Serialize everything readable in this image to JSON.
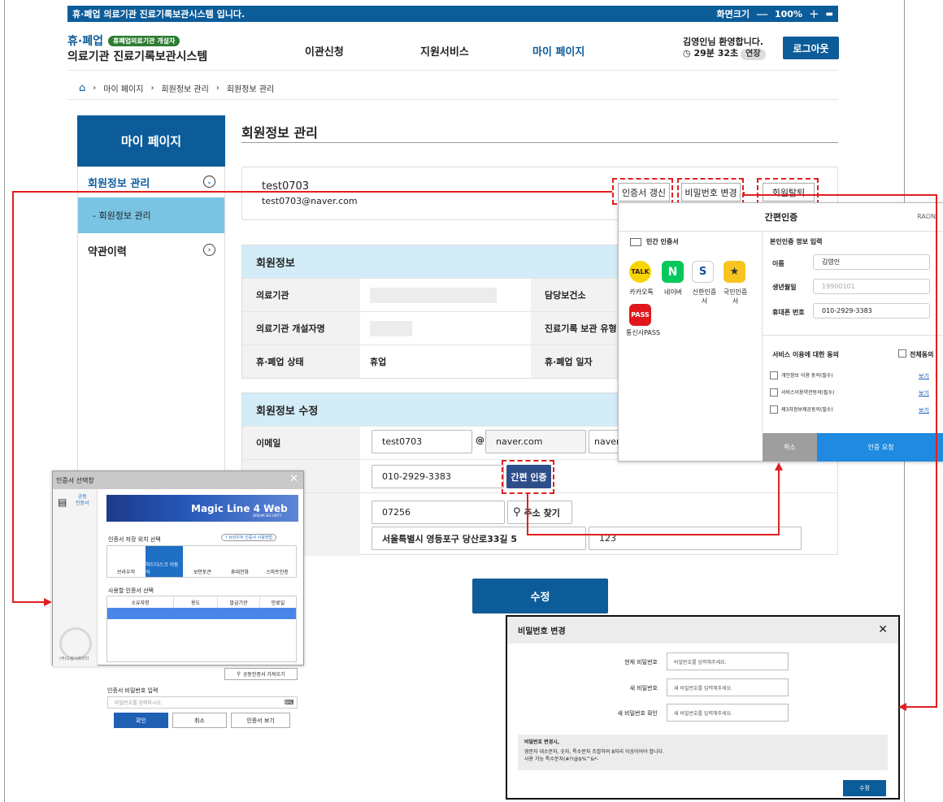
{
  "topbar": {
    "title": "휴·폐업 의료기관 진료기록보관시스템 입니다.",
    "font_label": "화면크기",
    "minus": "—",
    "zoom": "100%",
    "plus": "+",
    "print_icon": "print-icon"
  },
  "header": {
    "brand_line1": "휴·폐업",
    "brand_badge": "휴폐업의료기관 개설자",
    "brand_line2": "의료기관 진료기록보관시스템",
    "nav": [
      "이관신청",
      "지원서비스",
      "마이 페이지"
    ],
    "welcome": "김영인님 환영합니다.",
    "timer": "29분 32초",
    "extend": "연장",
    "logout": "로그아웃"
  },
  "breadcrumb": [
    "마이 페이지",
    "회원정보 관리",
    "회원정보 관리"
  ],
  "sidebar": {
    "title": "마이 페이지",
    "items": [
      {
        "label": "회원정보 관리",
        "icon": "chevron-down-circle-icon"
      },
      {
        "label": "- 회원정보 관리"
      },
      {
        "label": "약관이력",
        "icon": "chevron-right-circle-icon"
      }
    ]
  },
  "page": {
    "title": "회원정보 관리"
  },
  "user_card": {
    "id": "test0703",
    "email": "test0703@naver.com",
    "buttons": [
      "인증서 갱신",
      "비밀번호 변경",
      "회원탈퇴"
    ]
  },
  "member_info": {
    "title": "회원정보",
    "rows": [
      {
        "label": "의료기관",
        "label2": "담당보건소"
      },
      {
        "label": "의료기관 개설자명",
        "label2": "진료기록 보관 유형"
      },
      {
        "label": "휴·폐업 상태",
        "value": "휴업",
        "label2": "휴·폐업 일자"
      }
    ]
  },
  "member_edit": {
    "title": "회원정보 수정",
    "email_label": "이메일",
    "email_id": "test0703",
    "at": "@",
    "email_domain": "naver.com",
    "email_select": "naver",
    "phone": "010-2929-3383",
    "easy_auth": "간편 인증",
    "zipcode": "07256",
    "address_search": "주소 찾기",
    "address1": "서울특별시 영등포구 당산로33길 5",
    "address2": "123"
  },
  "submit_button": "수정",
  "easy_auth_modal": {
    "title": "간편인증",
    "brand": "RAON",
    "left_title": "민간 인증서",
    "providers": [
      "카카오톡",
      "네이버",
      "신한인증서",
      "국민인증서",
      "통신사PASS"
    ],
    "provider_icons": {
      "kakao": "TALK",
      "naver": "N",
      "shinhan": "S",
      "kb": "★",
      "pass": "PASS"
    },
    "right_title": "본인인증 정보 입력",
    "name_label": "이름",
    "name_value": "김영인",
    "birth_label": "생년월일",
    "birth_placeholder": "19900101",
    "phone_label": "휴대폰 번호",
    "phone_value": "010-2929-3383",
    "agree_title": "서비스 이용에 대한 동의",
    "agree_all": "전체동의",
    "agree_items": [
      "개인정보 이용 동의(필수)",
      "서비스이용약관동의(필수)",
      "제3자정보제공동의(필수)"
    ],
    "view": "보기",
    "cancel": "취소",
    "request": "인증 요청"
  },
  "cert_modal": {
    "title": "인증서 선택창",
    "left_label1": "공동",
    "left_label2": "인증서",
    "banner": "Magic Line 4 Web",
    "banner_logo": "DREAM SECURITY",
    "location_label": "인증서 저장 위치 선택",
    "help": "브라우저 인증서 사용방법",
    "locations": [
      "브라우저",
      "하드디스크 이동식",
      "보안토큰",
      "휴대전화",
      "스마트인증"
    ],
    "list_label": "사용할 인증서 선택",
    "columns": [
      "소유자명",
      "용도",
      "발급기관",
      "만료일"
    ],
    "import": "공동인증서 가져오기",
    "password_label": "인증서 비밀번호 입력",
    "password_placeholder": "비밀번호를 입력하시오.",
    "confirm": "확인",
    "cancel": "취소",
    "view": "인증서 보기",
    "footer": "(주)드림시큐리티"
  },
  "password_modal": {
    "title": "비밀번호 변경",
    "fields": [
      {
        "label": "현재 비밀번호",
        "placeholder": "비밀번호를 입력해주세요."
      },
      {
        "label": "새 비밀번호",
        "placeholder": "새 비밀번호를 입력해주세요."
      },
      {
        "label": "새 비밀번호 확인",
        "placeholder": "새 비밀번호를 입력해주세요."
      }
    ],
    "note_title": "비밀번호 변경시,",
    "note1": "영문자 대소문자, 숫자, 특수문자 조합하여 8자리 이상이어야 합니다.",
    "note2": "사용 가능 특수문자(#?!@$%^&*-",
    "submit": "수정"
  },
  "colors": {
    "primary": "#0c5c9a",
    "highlight": "#e02020",
    "section": "#d3ecf8",
    "sidebar_active": "#79c4e3",
    "easy_request": "#1f8ae0"
  }
}
